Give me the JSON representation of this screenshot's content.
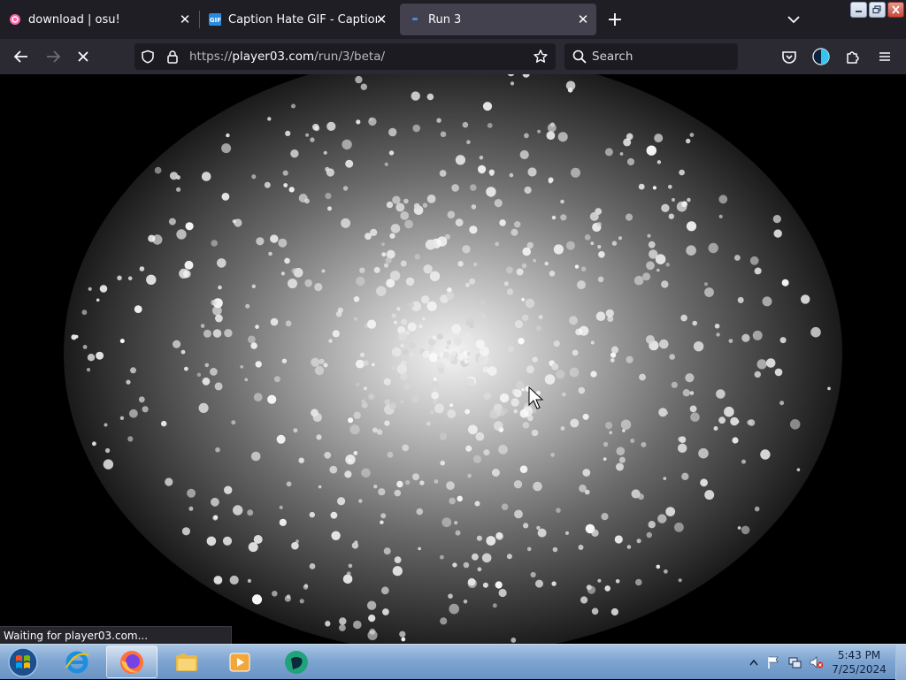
{
  "tabs": [
    {
      "title": "download | osu!",
      "favicon": "osu-icon",
      "active": false
    },
    {
      "title": "Caption Hate GIF - Caption I Ha",
      "favicon": "gif-icon",
      "active": false
    },
    {
      "title": "Run 3",
      "favicon": "run3-icon",
      "active": true
    }
  ],
  "new_tab_label": "+",
  "navbar": {
    "url_prefix": "https://",
    "url_host": "player03.com",
    "url_path": "/run/3/beta/",
    "search_placeholder": "Search"
  },
  "status_text": "Waiting for player03.com...",
  "taskbar": {
    "apps": [
      "internet-explorer-icon",
      "firefox-icon",
      "file-explorer-icon",
      "media-player-icon",
      "app-icon"
    ],
    "time": "5:43 PM",
    "date": "7/25/2024"
  },
  "colors": {
    "tabstrip": "#1f1e25",
    "active_tab": "#42414d",
    "navbar": "#2b2a33",
    "urlbar": "#1c1b22",
    "osu_pink": "#ff66aa",
    "gif_blue": "#2a8ae0"
  }
}
